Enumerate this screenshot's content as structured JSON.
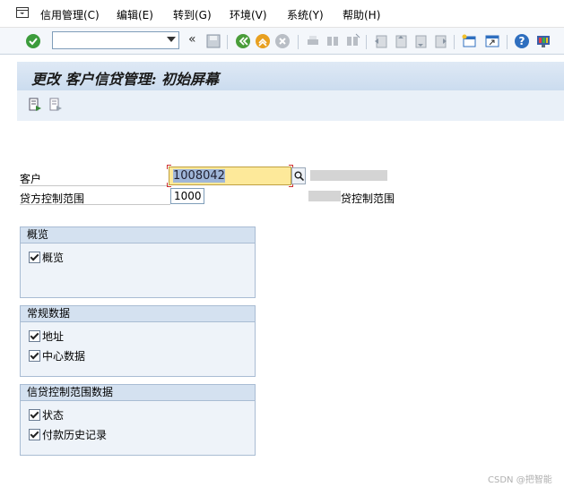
{
  "menubar": {
    "items": [
      {
        "label": "信用管理(C)"
      },
      {
        "label": "编辑(E)"
      },
      {
        "label": "转到(G)"
      },
      {
        "label": "环境(V)"
      },
      {
        "label": "系统(Y)"
      },
      {
        "label": "帮助(H)"
      }
    ]
  },
  "toolbar": {
    "command_field": {
      "value": "",
      "placeholder": ""
    },
    "colors": {
      "enter": "#3c9c3c",
      "back": "#4a9d3a",
      "exit": "#e8a020",
      "cancel": "#c04040",
      "help": "#2f6fbf"
    }
  },
  "title": {
    "text": "更改 客户信贷管理: 初始屏幕"
  },
  "form": {
    "customer": {
      "label": "客户",
      "value": "1008042"
    },
    "credit_area": {
      "label": "贷方控制范围",
      "value": "1000",
      "description": "贷控制范围"
    }
  },
  "groups": {
    "overview": {
      "title": "概览",
      "items": [
        {
          "label": "概览",
          "checked": true
        }
      ]
    },
    "general": {
      "title": "常规数据",
      "items": [
        {
          "label": "地址",
          "checked": true
        },
        {
          "label": "中心数据",
          "checked": true
        }
      ]
    },
    "credit_area_data": {
      "title": "信贷控制范围数据",
      "items": [
        {
          "label": "状态",
          "checked": true
        },
        {
          "label": "付款历史记录",
          "checked": true
        }
      ]
    }
  },
  "watermark": {
    "text": "CSDN @把智能"
  }
}
